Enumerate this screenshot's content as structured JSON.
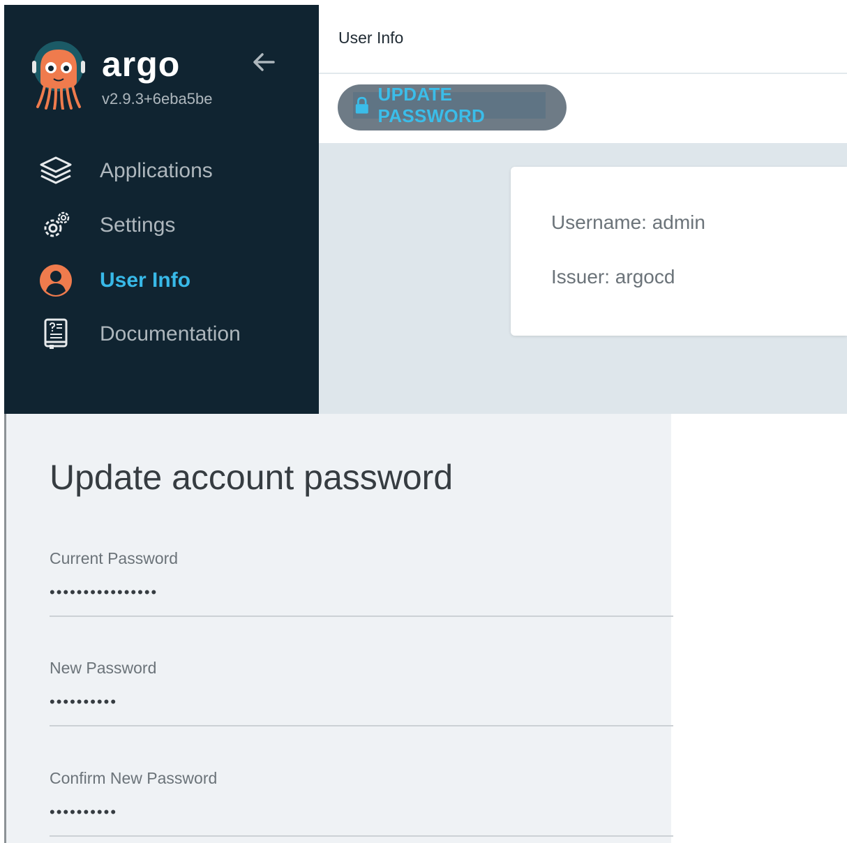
{
  "sidebar": {
    "brand": "argo",
    "version": "v2.9.3+6eba5be",
    "collapse_icon": "arrow-left-icon",
    "items": [
      {
        "label": "Applications",
        "icon": "layers-icon",
        "active": false
      },
      {
        "label": "Settings",
        "icon": "gears-icon",
        "active": false
      },
      {
        "label": "User Info",
        "icon": "user-circle-icon",
        "active": true
      },
      {
        "label": "Documentation",
        "icon": "book-icon",
        "active": false
      }
    ]
  },
  "header": {
    "title": "User Info"
  },
  "toolbar": {
    "update_password_label": "UPDATE PASSWORD",
    "lock_icon": "lock-icon"
  },
  "user_info": {
    "username": "Username: admin",
    "issuer": "Issuer: argocd"
  },
  "modal": {
    "title": "Update account password",
    "fields": [
      {
        "label": "Current Password",
        "value": "••••••••••••••••"
      },
      {
        "label": "New Password",
        "value": "••••••••••"
      },
      {
        "label": "Confirm New Password",
        "value": "••••••••••"
      }
    ]
  },
  "colors": {
    "sidebar_bg": "#102431",
    "accent": "#38b9e8",
    "brand_orange": "#ef7b4d",
    "content_bg": "#dee6eb",
    "modal_bg": "#eff2f5"
  }
}
